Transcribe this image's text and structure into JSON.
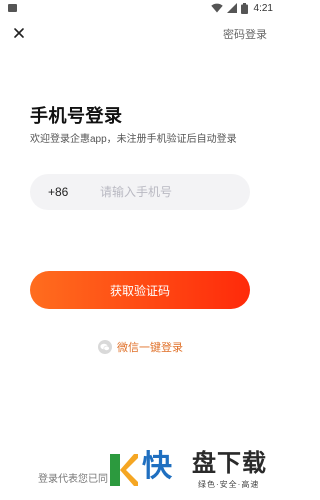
{
  "status_bar": {
    "time": "4:21"
  },
  "header": {
    "close_icon": "close-icon",
    "password_login": "密码登录"
  },
  "title": "手机号登录",
  "subtitle": "欢迎登录企惠app，未注册手机验证后自动登录",
  "phone": {
    "country_code": "+86",
    "value": "",
    "placeholder": "请输入手机号"
  },
  "get_code_button": "获取验证码",
  "wechat_login": {
    "icon": "wechat-icon",
    "label": "微信一键登录"
  },
  "agreement": "登录代表您已同",
  "watermark": {
    "char": "快",
    "brand": "盘下载",
    "slogan": "绿色·安全·高速"
  },
  "colors": {
    "accent_start": "#ff6d1e",
    "accent_end": "#ff2a0a",
    "wechat_text": "#e0712a"
  }
}
